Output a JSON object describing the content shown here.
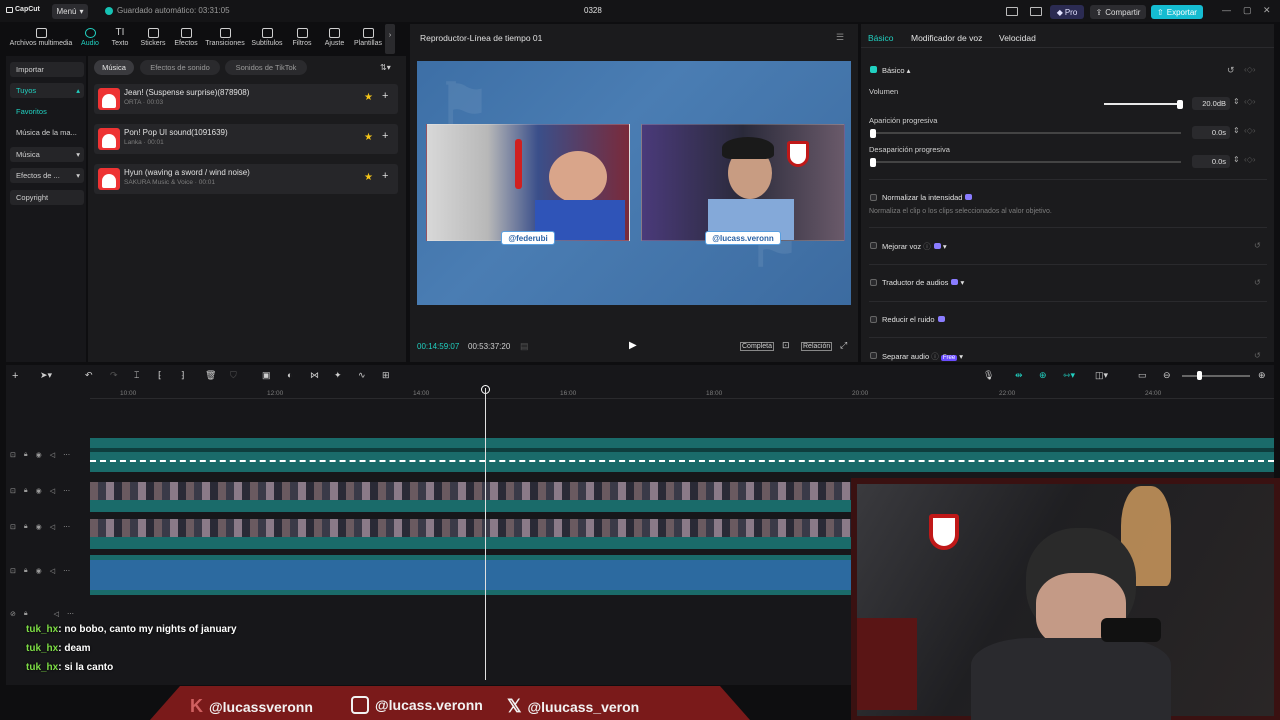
{
  "topbar": {
    "logo": "CapCut",
    "menu": "Menú",
    "autosave": "Guardado automático: 03:31:05",
    "project": "0328",
    "pro": "Pro",
    "share": "Compartir",
    "export": "Exportar"
  },
  "tools": [
    {
      "label": "Archivos multimedia"
    },
    {
      "label": "Audio"
    },
    {
      "label": "Texto"
    },
    {
      "label": "Stickers"
    },
    {
      "label": "Efectos"
    },
    {
      "label": "Transiciones"
    },
    {
      "label": "Subtítulos"
    },
    {
      "label": "Filtros"
    },
    {
      "label": "Ajuste"
    },
    {
      "label": "Plantillas"
    }
  ],
  "sidebar": {
    "importar": "Importar",
    "tuyos": "Tuyos",
    "favoritos": "Favoritos",
    "musica_ma": "Música de la ma...",
    "musica": "Música",
    "efectos": "Efectos de ...",
    "copyright": "Copyright"
  },
  "chips": {
    "musica": "Música",
    "efectos": "Efectos de sonido",
    "tiktok": "Sonidos de TikTok"
  },
  "tracks": [
    {
      "name": "Jean! (Suspense surprise)(878908)",
      "sub": "ORTA · 00:03"
    },
    {
      "name": "Pon! Pop UI sound(1091639)",
      "sub": "Lanka · 00:01"
    },
    {
      "name": "Hyun (waving a sword / wind noise)",
      "sub": "SAKURA Music & Voice · 00:01"
    }
  ],
  "player": {
    "title": "Reproductor-Línea de tiempo 01",
    "current": "00:14:59:07",
    "total": "00:53:37:20",
    "complete": "Completa",
    "ratio": "Relación",
    "handle_left": "@federubi",
    "handle_right": "@lucass.veronn"
  },
  "right": {
    "tabs": {
      "basic": "Básico",
      "voice": "Modificador de voz",
      "speed": "Velocidad"
    },
    "section": "Básico",
    "volume_label": "Volumen",
    "volume_value": "20.0dB",
    "volume_level": 0.98,
    "fadein_label": "Aparición progresiva",
    "fadein_value": "0.0s",
    "fadeout_label": "Desaparición progresiva",
    "fadeout_value": "0.0s",
    "normalize": "Normalizar la intensidad",
    "normalize_hint": "Normaliza el clip o los clips seleccionados al valor objetivo.",
    "enhance": "Mejorar voz",
    "translate": "Traductor de audios",
    "noise": "Reducir el ruido",
    "separate": "Separar audio",
    "free": "Free"
  },
  "ruler": [
    "10:00",
    "12:00",
    "14:00",
    "16:00",
    "18:00",
    "20:00",
    "22:00",
    "24:00"
  ],
  "chat": [
    {
      "user": "tuk_hx",
      "msg": ": no bobo, canto my nights of january"
    },
    {
      "user": "tuk_hx",
      "msg": ": deam"
    },
    {
      "user": "tuk_hx",
      "msg": ": si la canto"
    }
  ],
  "socials": {
    "kick": "@lucassveronn",
    "instagram": "@lucass.veronn",
    "x": "@luucass_veron"
  }
}
